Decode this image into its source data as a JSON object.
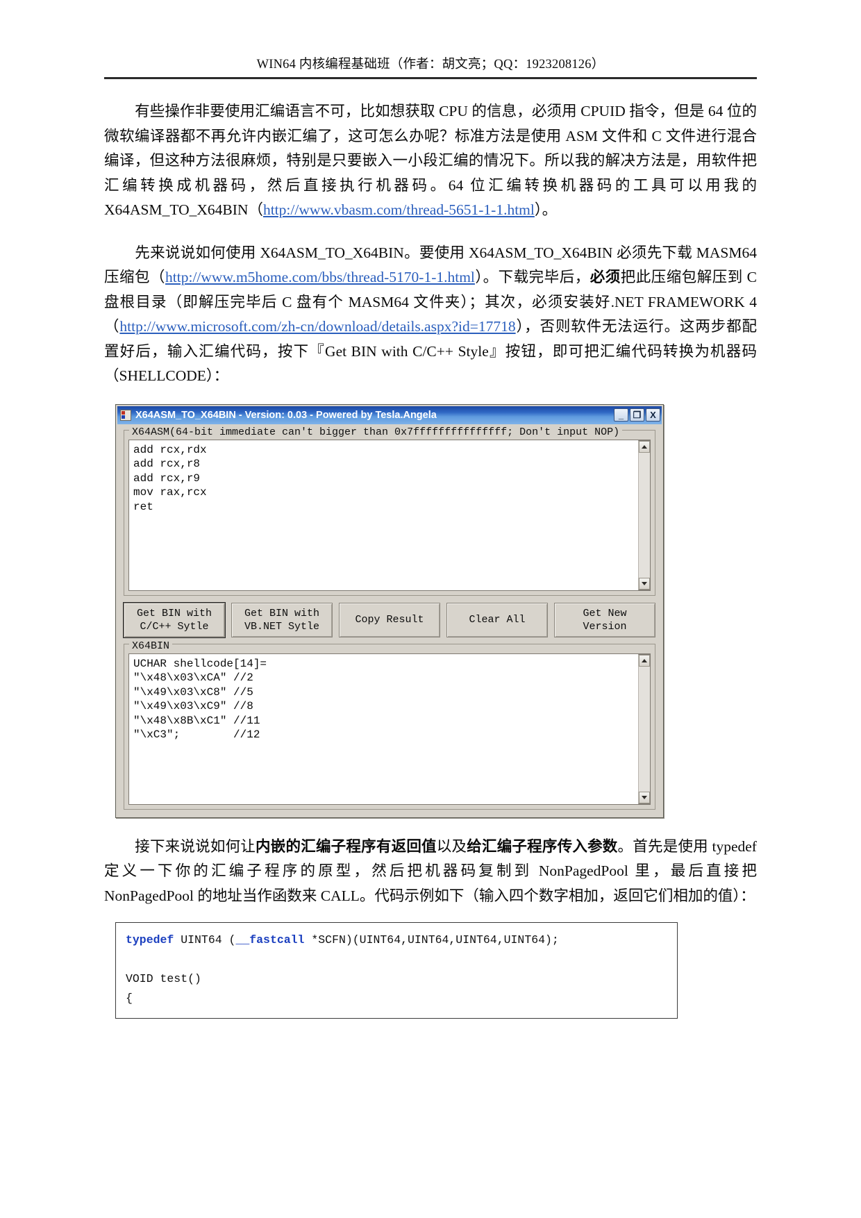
{
  "header": {
    "text": "WIN64 内核编程基础班（作者：胡文亮；QQ：1923208126）"
  },
  "paragraphs": {
    "p1_a": "有些操作非要使用汇编语言不可，比如想获取 CPU 的信息，必须用 CPUID 指令，但是 64 位的微软编译器都不再允许内嵌汇编了，这可怎么办呢？标准方法是使用 ASM 文件和 C 文件进行混合编译，但这种方法很麻烦，特别是只要嵌入一小段汇编的情况下。所以我的解决方法是，用软件把汇编转换成机器码，然后直接执行机器码。64 位汇编转换机器码的工具可以用我的 X64ASM_TO_X64BIN（",
    "p1_link": "http://www.vbasm.com/thread-5651-1-1.html",
    "p1_b": "）。",
    "p2_a": "先来说说如何使用 X64ASM_TO_X64BIN。要使用 X64ASM_TO_X64BIN 必须先下载 MASM64 压缩包（",
    "p2_link1": "http://www.m5home.com/bbs/thread-5170-1-1.html",
    "p2_b": "）。下载完毕后，",
    "p2_bold1": "必须",
    "p2_c": "把此压缩包解压到 C 盘根目录（即解压完毕后 C 盘有个 MASM64 文件夹）；其次，必须安装好.NET FRAMEWORK 4（",
    "p2_link2": "http://www.microsoft.com/zh-cn/download/details.aspx?id=17718",
    "p2_d": "），否则软件无法运行。这两步都配置好后，输入汇编代码，按下『Get BIN with C/C++ Style』按钮，即可把汇编代码转换为机器码（SHELLCODE）："
  },
  "app_window": {
    "title": "X64ASM_TO_X64BIN - Version: 0.03 - Powered by Tesla.Angela",
    "window_buttons": {
      "minimize": "_",
      "maximize": "❐",
      "close": "X"
    },
    "asm_group": {
      "label": "X64ASM(64-bit immediate can't bigger than 0x7fffffffffffffff; Don't input NOP)",
      "code": "add rcx,rdx\nadd rcx,r8\nadd rcx,r9\nmov rax,rcx\nret"
    },
    "buttons": [
      "Get BIN with\nC/C++ Sytle",
      "Get BIN with\nVB.NET Sytle",
      "Copy Result",
      "Clear All",
      "Get New\nVersion"
    ],
    "bin_group": {
      "label": "X64BIN",
      "code": "UCHAR shellcode[14]=\n\"\\x48\\x03\\xCA\" //2\n\"\\x49\\x03\\xC8\" //5\n\"\\x49\\x03\\xC9\" //8\n\"\\x48\\x8B\\xC1\" //11\n\"\\xC3\";        //12"
    }
  },
  "paragraph3": {
    "a": "接下来说说如何让",
    "bold1": "内嵌的汇编子程序有返回值",
    "b": "以及",
    "bold2": "给汇编子程序传入参数",
    "c": "。首先是使用 typedef 定义一下你的汇编子程序的原型，然后把机器码复制到 NonPagedPool 里，最后直接把 NonPagedPool 的地址当作函数来 CALL。代码示例如下（输入四个数字相加，返回它们相加的值）："
  },
  "code_block": {
    "kw1": "typedef",
    "line1_rest": " UINT64 ",
    "kw2": "__fastcall",
    "line1_end": " *SCFN)(UINT64,UINT64,UINT64,UINT64);",
    "paren_open": "(",
    "line2": "",
    "line3": "VOID test()",
    "line4": "{"
  },
  "colors": {
    "link": "#2b5fbd",
    "titlebar_start": "#1d49a4",
    "titlebar_end": "#7fb2e8",
    "window_face": "#d6d2ca",
    "code_keyword": "#1b3fbf"
  }
}
